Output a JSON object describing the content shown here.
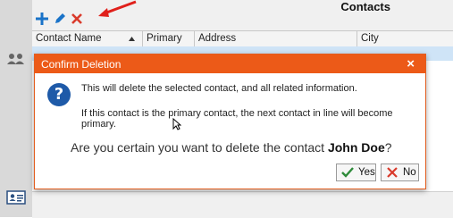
{
  "window": {
    "title": "Contacts"
  },
  "sidebar": {
    "items": [
      {
        "icon": "contacts-group-icon"
      },
      {
        "icon": "contact-card-icon"
      }
    ]
  },
  "toolbar": {
    "buttons": [
      {
        "icon": "add-icon",
        "color": "#1a73c8"
      },
      {
        "icon": "edit-pencil-icon",
        "color": "#1a73c8"
      },
      {
        "icon": "delete-x-icon",
        "color": "#d93a2b"
      }
    ]
  },
  "grid": {
    "columns": [
      "Contact Name",
      "Primary",
      "Address",
      "City"
    ],
    "sort_column": "Contact Name",
    "sort_direction": "ascending"
  },
  "dialog": {
    "title": "Confirm Deletion",
    "icon": "question-icon",
    "message_line1": "This will delete the selected contact, and all related information.",
    "message_line2": "If this contact is the primary contact, the next contact in line will become primary.",
    "prompt_prefix": "Are you certain you want to delete the contact ",
    "contact_name": "John Doe",
    "prompt_suffix": "?",
    "yes_label": "Yes",
    "no_label": "No",
    "close_label": "×"
  },
  "colors": {
    "dialog_title_bg": "#ec5a18",
    "accent": "#1a73c8",
    "danger": "#d93a2b",
    "yes_check": "#2e8b3a"
  }
}
